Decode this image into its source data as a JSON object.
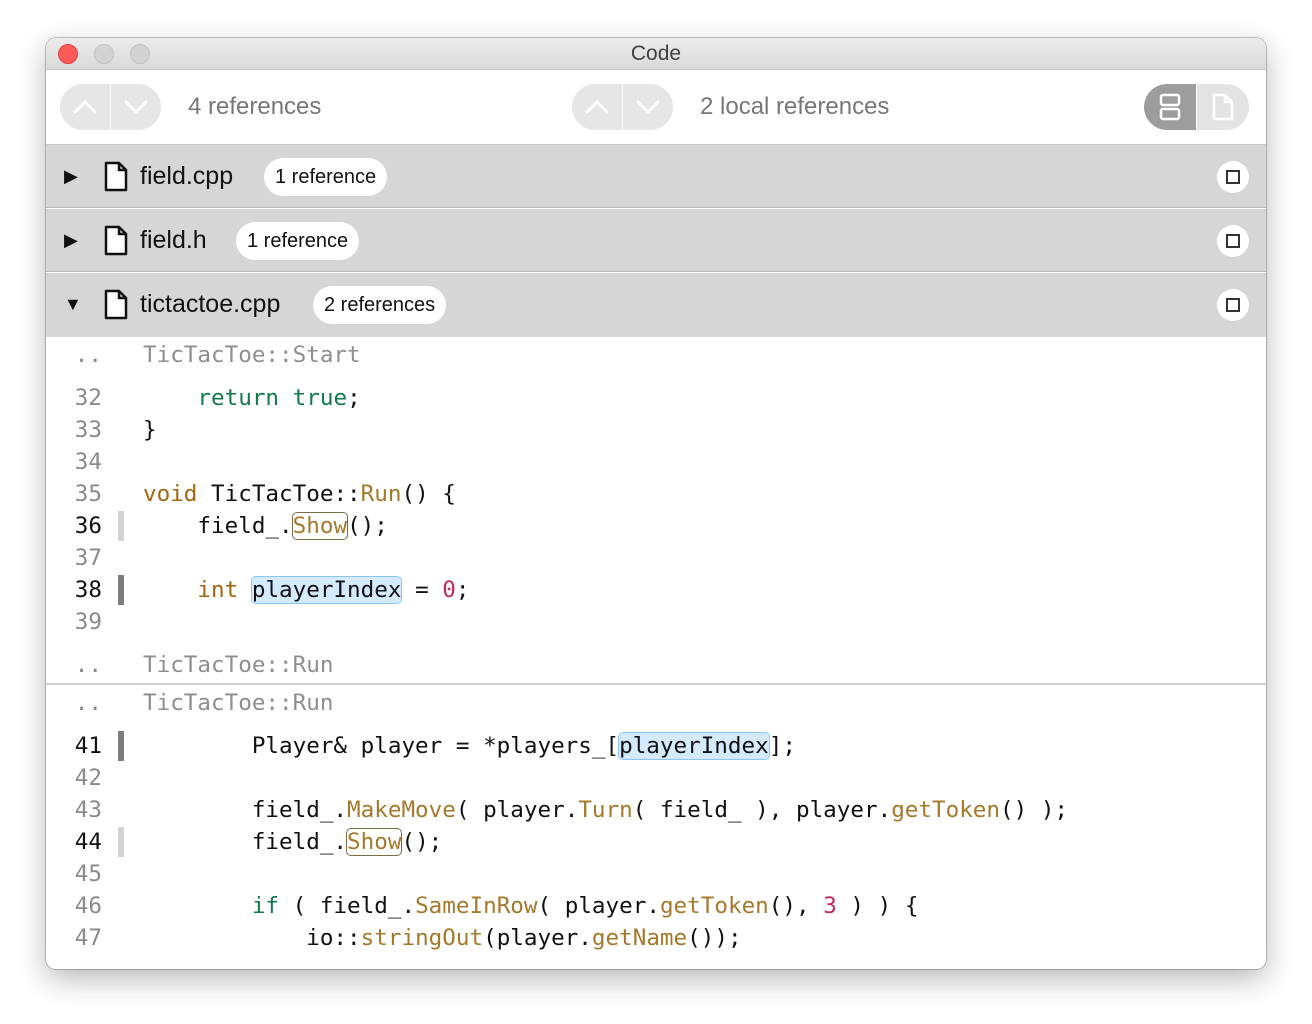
{
  "window": {
    "title": "Code"
  },
  "toolbar": {
    "references_label": "4 references",
    "local_references_label": "2 local references"
  },
  "files": [
    {
      "name": "field.cpp",
      "badge": "1 reference",
      "expanded": false
    },
    {
      "name": "field.h",
      "badge": "1 reference",
      "expanded": false
    },
    {
      "name": "tictactoe.cpp",
      "badge": "2 references",
      "expanded": true
    }
  ],
  "snippets": [
    {
      "context_top": "TicTacToe::Start",
      "lines": [
        {
          "num": "32",
          "code": "    return true;"
        },
        {
          "num": "33",
          "code": "}"
        },
        {
          "num": "34",
          "code": ""
        },
        {
          "num": "35",
          "code": "void TicTacToe::Run() {"
        },
        {
          "num": "36",
          "code": "    field_.Show();"
        },
        {
          "num": "37",
          "code": ""
        },
        {
          "num": "38",
          "code": "    int playerIndex = 0;"
        },
        {
          "num": "39",
          "code": ""
        }
      ],
      "context_bottom": "TicTacToe::Run"
    },
    {
      "context_top": "TicTacToe::Run",
      "lines": [
        {
          "num": "41",
          "code": "        Player& player = *players_[playerIndex];"
        },
        {
          "num": "42",
          "code": ""
        },
        {
          "num": "43",
          "code": "        field_.MakeMove( player.Turn( field_ ), player.getToken() );"
        },
        {
          "num": "44",
          "code": "        field_.Show();"
        },
        {
          "num": "45",
          "code": ""
        },
        {
          "num": "46",
          "code": "        if ( field_.SameInRow( player.getToken(), 3 ) ) {"
        },
        {
          "num": "47",
          "code": "            io::stringOut(player.getName());"
        }
      ]
    }
  ],
  "context_marker": "..",
  "colors": {
    "keyword": "#117a4b",
    "type": "#a36510",
    "function": "#a5782a",
    "number": "#c32a5b",
    "reference_highlight": "#d4ebff",
    "file_header_bg": "#d6d6d6"
  }
}
